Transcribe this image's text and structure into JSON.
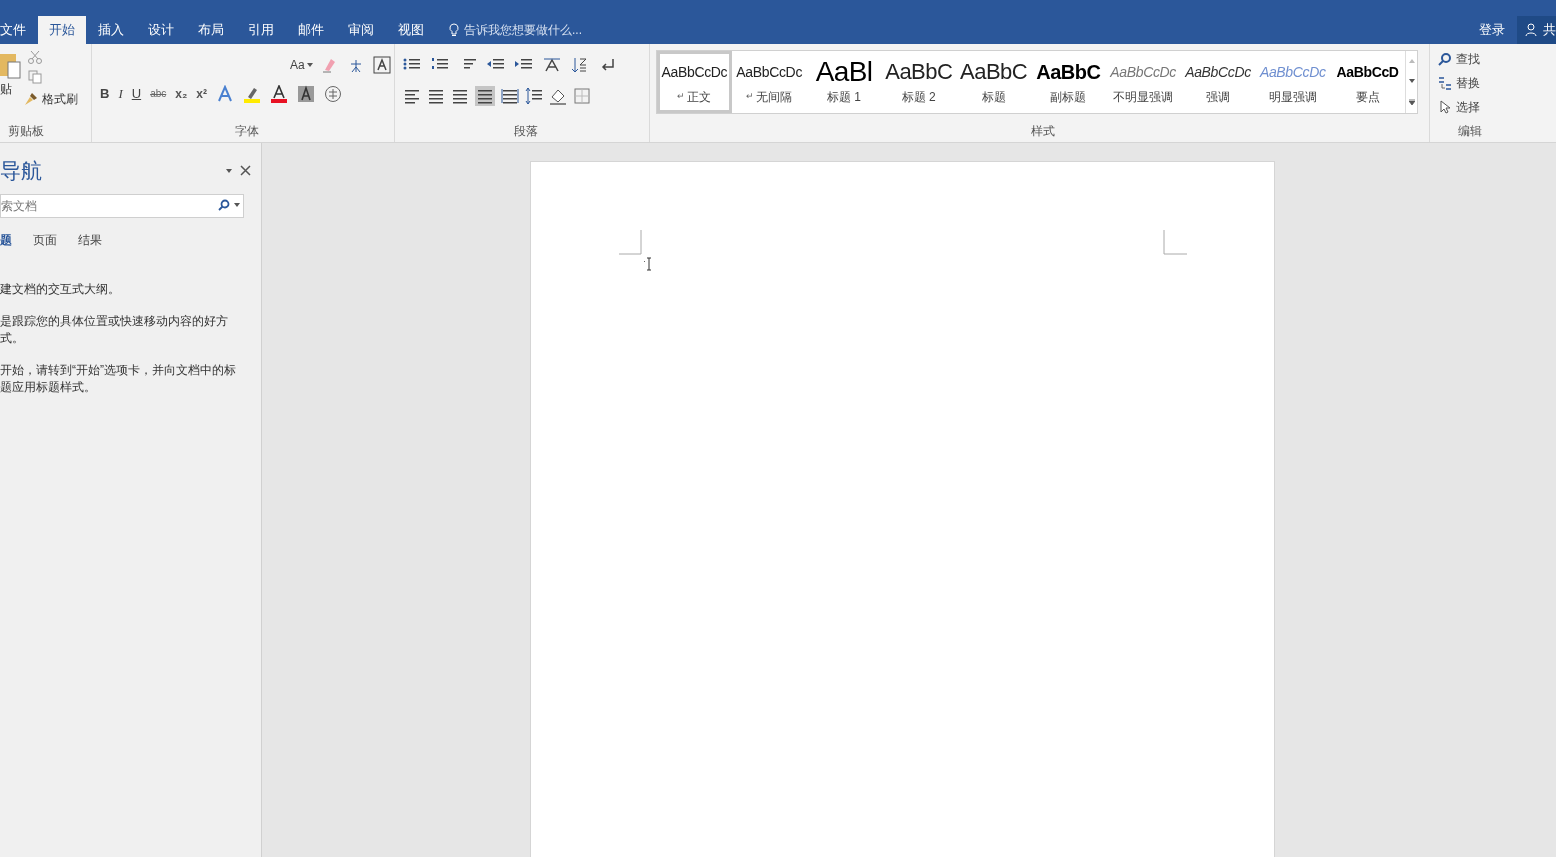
{
  "menu_tabs": [
    {
      "label": "文件",
      "selected": false
    },
    {
      "label": "开始",
      "selected": true
    },
    {
      "label": "插入",
      "selected": false
    },
    {
      "label": "设计",
      "selected": false
    },
    {
      "label": "布局",
      "selected": false
    },
    {
      "label": "引用",
      "selected": false
    },
    {
      "label": "邮件",
      "selected": false
    },
    {
      "label": "审阅",
      "selected": false
    },
    {
      "label": "视图",
      "selected": false
    }
  ],
  "tell_me": "告诉我您想要做什么...",
  "sign_in": "登录",
  "share": "共",
  "clipboard": {
    "paste": "贴",
    "format_painter": "格式刷",
    "label": "剪贴板"
  },
  "font": {
    "change_case": "Aa",
    "buttons": [
      "B",
      "I",
      "U",
      "abc",
      "x₂",
      "x²"
    ],
    "label": "字体"
  },
  "paragraph": {
    "label": "段落"
  },
  "styles": {
    "label": "样式",
    "items": [
      {
        "preview": "AaBbCcDc",
        "label": "正文",
        "para_mark": "↵",
        "kind": "normal",
        "selected": true
      },
      {
        "preview": "AaBbCcDc",
        "label": "无间隔",
        "para_mark": "↵",
        "kind": "normal",
        "selected": false
      },
      {
        "preview": "AaBl",
        "label": "标题 1",
        "kind": "heading1",
        "selected": false
      },
      {
        "preview": "AaBbC",
        "label": "标题 2",
        "kind": "heading2",
        "selected": false
      },
      {
        "preview": "AaBbC",
        "label": "标题",
        "kind": "title",
        "selected": false
      },
      {
        "preview": "AaBbC",
        "label": "副标题",
        "kind": "subtitle",
        "selected": false
      },
      {
        "preview": "AaBbCcDc",
        "label": "不明显强调",
        "kind": "subtle",
        "selected": false
      },
      {
        "preview": "AaBbCcDc",
        "label": "强调",
        "kind": "emphasis",
        "selected": false
      },
      {
        "preview": "AaBbCcDc",
        "label": "明显强调",
        "kind": "intense",
        "selected": false
      },
      {
        "preview": "AaBbCcD",
        "label": "要点",
        "kind": "strong",
        "selected": false
      }
    ]
  },
  "editing": {
    "label": "编辑",
    "items": [
      {
        "label": "查找",
        "kind": "find"
      },
      {
        "label": "替换",
        "kind": "replace"
      },
      {
        "label": "选择",
        "kind": "select"
      }
    ]
  },
  "navigation": {
    "title": "导航",
    "search_placeholder": "索文档",
    "tabs": [
      {
        "label": "题",
        "selected": true
      },
      {
        "label": "页面",
        "selected": false
      },
      {
        "label": "结果",
        "selected": false
      }
    ],
    "paragraphs": [
      "建文档的交互式大纲。",
      "是跟踪您的具体位置或快速移动内容的好方式。",
      "开始，请转到“开始”选项卡，并向文档中的标题应用标题样式。"
    ]
  }
}
